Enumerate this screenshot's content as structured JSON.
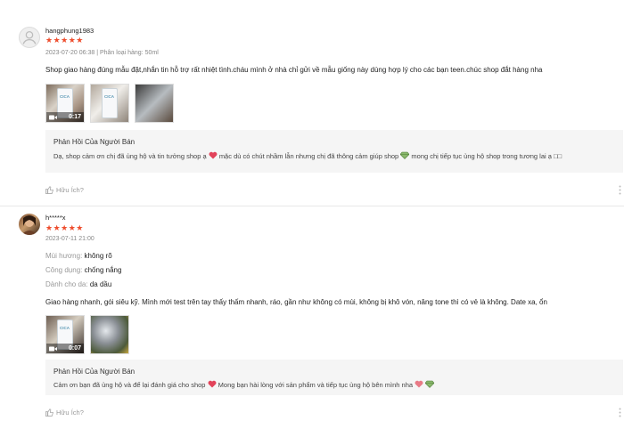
{
  "reviews": [
    {
      "author": "hangphung1983",
      "stars": "★★★★★",
      "meta": "2023-07-20 06:38 | Phân loại hàng: 50ml",
      "text": "Shop giao hàng đúng mẫu đặt,nhắn tin hỗ trợ rất nhiệt tình.cháu mình ở nhà chỉ gửi về mẫu giống này dùng hợp lý cho các bạn teen.chúc shop đắt hàng nha",
      "media": [
        {
          "type": "video",
          "duration": "0:17",
          "label": "CICA"
        },
        {
          "type": "photo",
          "label": "CICA"
        },
        {
          "type": "photo"
        }
      ],
      "reply": {
        "title": "Phản Hồi Của Người Bán",
        "part1": "Dạ, shop cảm ơn chị đã ủng hộ và tin tưởng shop ạ",
        "part2": "mặc dù có chút nhầm lẫn nhưng chị đã thông cảm giúp shop",
        "part3": "mong chị tiếp tục ủng hộ shop trong tương lai ạ",
        "tail": "□□"
      },
      "helpful": "Hữu Ích?"
    },
    {
      "author": "h*****x",
      "stars": "★★★★★",
      "meta": "2023-07-11 21:00",
      "attributes": [
        {
          "key": "Mùi hương:",
          "value": "không rõ"
        },
        {
          "key": "Công dụng:",
          "value": "chống nắng"
        },
        {
          "key": "Dành cho da:",
          "value": "da dầu"
        }
      ],
      "text": "Giao hàng nhanh, gói siêu kỹ. Mình mới test trên tay thấy thấm nhanh, ráo, gần như không có mùi, không bị khô vón, nâng tone thì có vẻ là không. Date xa, ổn",
      "media": [
        {
          "type": "video",
          "duration": "0:07",
          "label": "CICA"
        },
        {
          "type": "photo"
        }
      ],
      "reply": {
        "title": "Phản Hồi Của Người Bán",
        "part1": "Cảm ơn bạn đã ủng hộ và để lại đánh giá cho shop",
        "part2": "Mong bạn hài lòng với sản phẩm và tiếp tục ủng hộ bên mình nha"
      },
      "helpful": "Hữu Ích?"
    }
  ],
  "icons": {
    "avatar_default": "user-silhouette-icon",
    "heart": "red-heart-icon",
    "gem": "gem-icon",
    "video": "video-camera-icon",
    "like": "thumbs-up-icon",
    "more": "vertical-dots-icon"
  },
  "colors": {
    "star": "#ee4d2d",
    "heart": "#e2435a",
    "reply_bg": "#f5f5f5",
    "muted": "#999999"
  }
}
